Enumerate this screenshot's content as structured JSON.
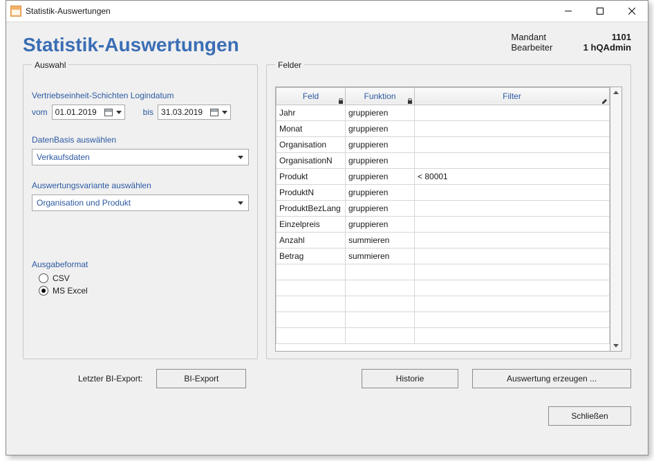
{
  "window": {
    "title": "Statistik-Auswertungen"
  },
  "header": {
    "main_title": "Statistik-Auswertungen",
    "mandant_lbl": "Mandant",
    "mandant_val": "1101",
    "bearbeiter_lbl": "Bearbeiter",
    "bearbeiter_val": "1  hQAdmin"
  },
  "auswahl": {
    "legend": "Auswahl",
    "login_label": "Vertriebseinheit-Schichten Logindatum",
    "vom_lbl": "vom",
    "vom_val": "01.01.2019",
    "bis_lbl": "bis",
    "bis_val": "31.03.2019",
    "datenbasis_lbl": "DatenBasis auswählen",
    "datenbasis_val": "Verkaufsdaten",
    "variante_lbl": "Auswertungsvariante auswählen",
    "variante_val": "Organisation und Produkt",
    "ausgabe_lbl": "Ausgabeformat",
    "format_csv": "CSV",
    "format_excel": "MS Excel",
    "format_selected": "excel"
  },
  "felder": {
    "legend": "Felder",
    "col_feld": "Feld",
    "col_funktion": "Funktion",
    "col_filter": "Filter",
    "rows": [
      {
        "feld": "Jahr",
        "funktion": "gruppieren",
        "filter": ""
      },
      {
        "feld": "Monat",
        "funktion": "gruppieren",
        "filter": ""
      },
      {
        "feld": "Organisation",
        "funktion": "gruppieren",
        "filter": ""
      },
      {
        "feld": "OrganisationN",
        "funktion": "gruppieren",
        "filter": ""
      },
      {
        "feld": "Produkt",
        "funktion": "gruppieren",
        "filter": "< 80001"
      },
      {
        "feld": "ProduktN",
        "funktion": "gruppieren",
        "filter": ""
      },
      {
        "feld": "ProduktBezLang",
        "funktion": "gruppieren",
        "filter": ""
      },
      {
        "feld": "Einzelpreis",
        "funktion": "gruppieren",
        "filter": ""
      },
      {
        "feld": "Anzahl",
        "funktion": "summieren",
        "filter": ""
      },
      {
        "feld": "Betrag",
        "funktion": "summieren",
        "filter": ""
      }
    ],
    "extra_blank_rows": 5
  },
  "buttons": {
    "last_export_lbl": "Letzter BI-Export:",
    "bi_export": "BI-Export",
    "historie": "Historie",
    "auswertung": "Auswertung erzeugen ...",
    "schliessen": "Schließen"
  }
}
